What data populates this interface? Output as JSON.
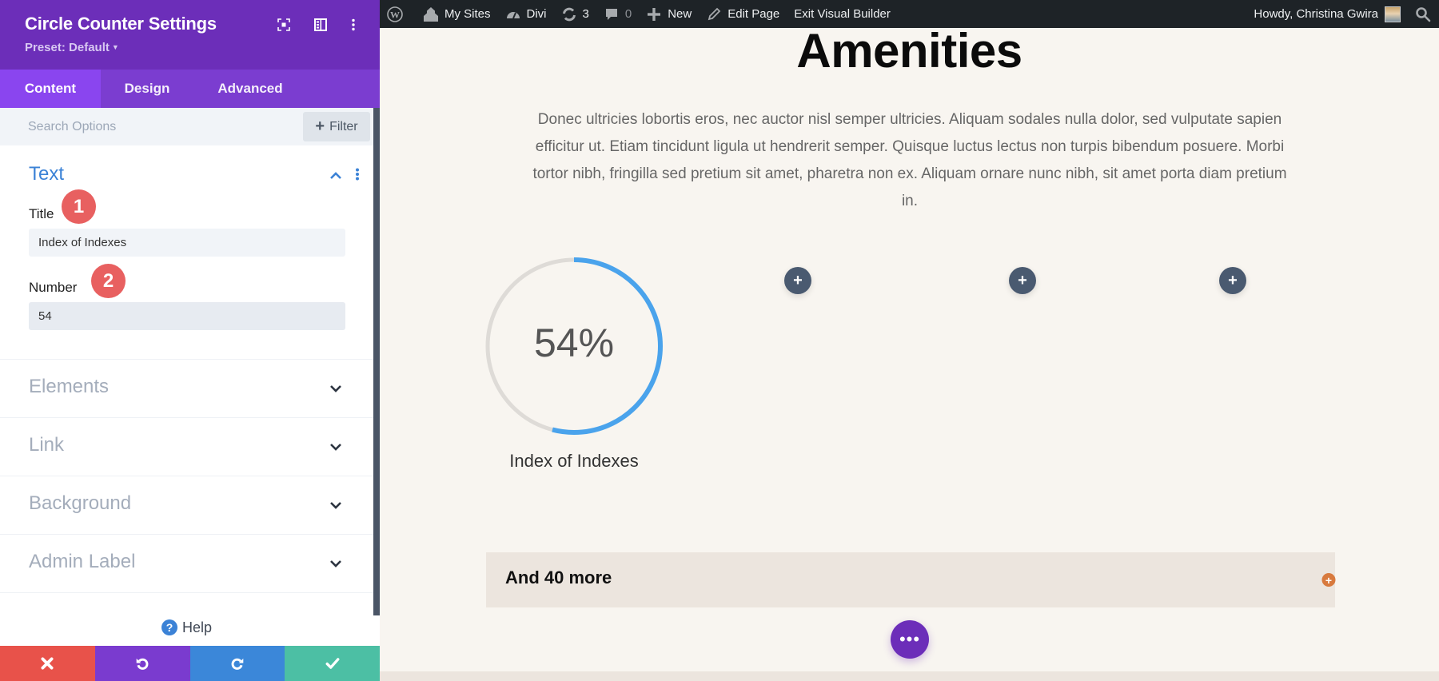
{
  "panel": {
    "title": "Circle Counter Settings",
    "preset": "Preset: Default",
    "header_icons": [
      "focus-icon",
      "split-view-icon",
      "more-options-icon"
    ],
    "tabs": [
      {
        "label": "Content",
        "active": true
      },
      {
        "label": "Design",
        "active": false
      },
      {
        "label": "Advanced",
        "active": false
      }
    ],
    "search": {
      "placeholder": "Search Options",
      "value": ""
    },
    "filter_label": "Filter",
    "text_section": {
      "title": "Text",
      "fields": [
        {
          "label": "Title",
          "value": "Index of Indexes",
          "badge": "1"
        },
        {
          "label": "Number",
          "value": "54",
          "badge": "2"
        }
      ]
    },
    "collapsed_sections": [
      "Elements",
      "Link",
      "Background",
      "Admin Label"
    ],
    "help_label": "Help",
    "footer_buttons": [
      {
        "name": "discard",
        "color": "#e8524a"
      },
      {
        "name": "undo",
        "color": "#7a3bcf"
      },
      {
        "name": "redo",
        "color": "#3b87d9"
      },
      {
        "name": "save",
        "color": "#4cbfa4"
      }
    ]
  },
  "adminbar": {
    "items": [
      {
        "icon": "wordpress-logo-icon",
        "label": ""
      },
      {
        "icon": "my-sites-icon",
        "label": "My Sites"
      },
      {
        "icon": "divi-dashboard-icon",
        "label": "Divi"
      },
      {
        "icon": "updates-icon",
        "label": "3"
      },
      {
        "icon": "comments-icon",
        "label": "0"
      },
      {
        "icon": "plus-icon",
        "label": "New"
      },
      {
        "icon": "pencil-icon",
        "label": "Edit Page"
      },
      {
        "icon": "",
        "label": "Exit Visual Builder"
      }
    ],
    "greeting": "Howdy, Christina Gwira"
  },
  "page": {
    "heading": "Amenities",
    "paragraph": "Donec ultricies lobortis eros, nec auctor nisl semper ultricies. Aliquam sodales nulla dolor, sed vulputate sapien efficitur ut. Etiam tincidunt ligula ut hendrerit semper. Quisque luctus lectus non turpis bibendum posuere. Morbi tortor nibh, fringilla sed pretium sit amet, pharetra non ex. Aliquam ornare nunc nibh, sit amet porta diam pretium in.",
    "counter": {
      "percent": 54,
      "display": "54%",
      "title": "Index of Indexes",
      "bar_color": "#4aa3ec",
      "track_color": "#dedbd7"
    },
    "accordion_title": "And 40 more"
  },
  "colors": {
    "panel_header": "#6c2eb9",
    "tabs": "#7b3dd0",
    "active_tab": "#8a45ef",
    "accent_blue": "#3b82d6",
    "badge": "#e86060",
    "page_bg": "#f8f5f0"
  }
}
